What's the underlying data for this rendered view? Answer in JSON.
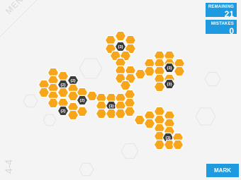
{
  "menu": {
    "label": "MENU"
  },
  "level": {
    "label": "4-4"
  },
  "remaining": {
    "label": "REMAINING",
    "value": "21"
  },
  "mistakes": {
    "label": "MISTAKES",
    "value": "0"
  },
  "mark": {
    "label": "MARK"
  },
  "colors": {
    "orange": "#f7a51b",
    "dark": "#3b3b3b",
    "blue": "#1e9be0",
    "background": "#f4f4f4"
  },
  "board": {
    "clue_labels": [
      "{3}",
      "{3}",
      "{3}",
      "{2}",
      "{2}",
      "{2}",
      "{2}",
      "{3}",
      "{3}"
    ]
  }
}
